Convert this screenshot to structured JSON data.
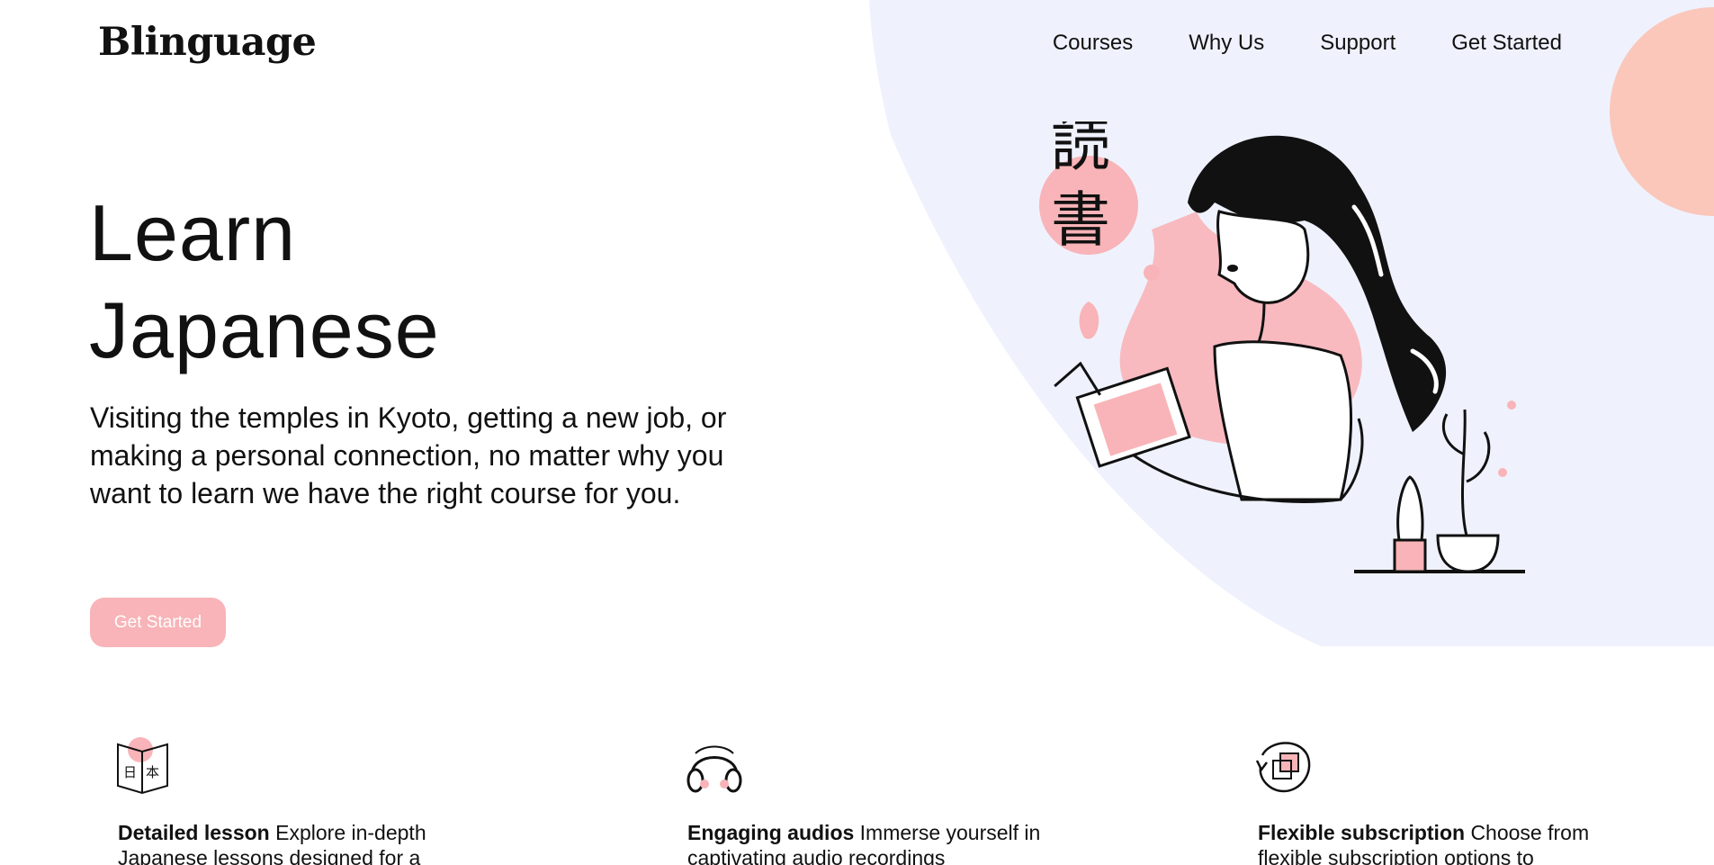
{
  "brand": {
    "name": "Blinguage",
    "colors": {
      "accent_pink": "#f8b4b8",
      "blob_lavender": "#eff2fd",
      "circle_salmon": "#fbc7bb",
      "text": "#111111"
    }
  },
  "nav": {
    "items": [
      "Courses",
      "Why Us",
      "Support",
      "Get Started"
    ]
  },
  "hero": {
    "title_line1": "Learn",
    "title_line2": "Japanese",
    "description": "Visiting the temples in Kyoto, getting a new job, or making a personal connection, no matter why you want to learn we have the right course for you.",
    "cta_label": "Get Started",
    "illustration_kanji": [
      "読",
      "書"
    ],
    "illustration_name": "woman-reading-book-illustration"
  },
  "features": [
    {
      "icon": "book-icon",
      "title": "Detailed lesson",
      "text": "Explore in-depth Japanese lessons designed for a"
    },
    {
      "icon": "headphones-icon",
      "title": "Engaging audios",
      "text": "Immerse yourself in captivating audio recordings"
    },
    {
      "icon": "refresh-subscription-icon",
      "title": "Flexible subscription",
      "text": "Choose from flexible subscription options to"
    }
  ]
}
